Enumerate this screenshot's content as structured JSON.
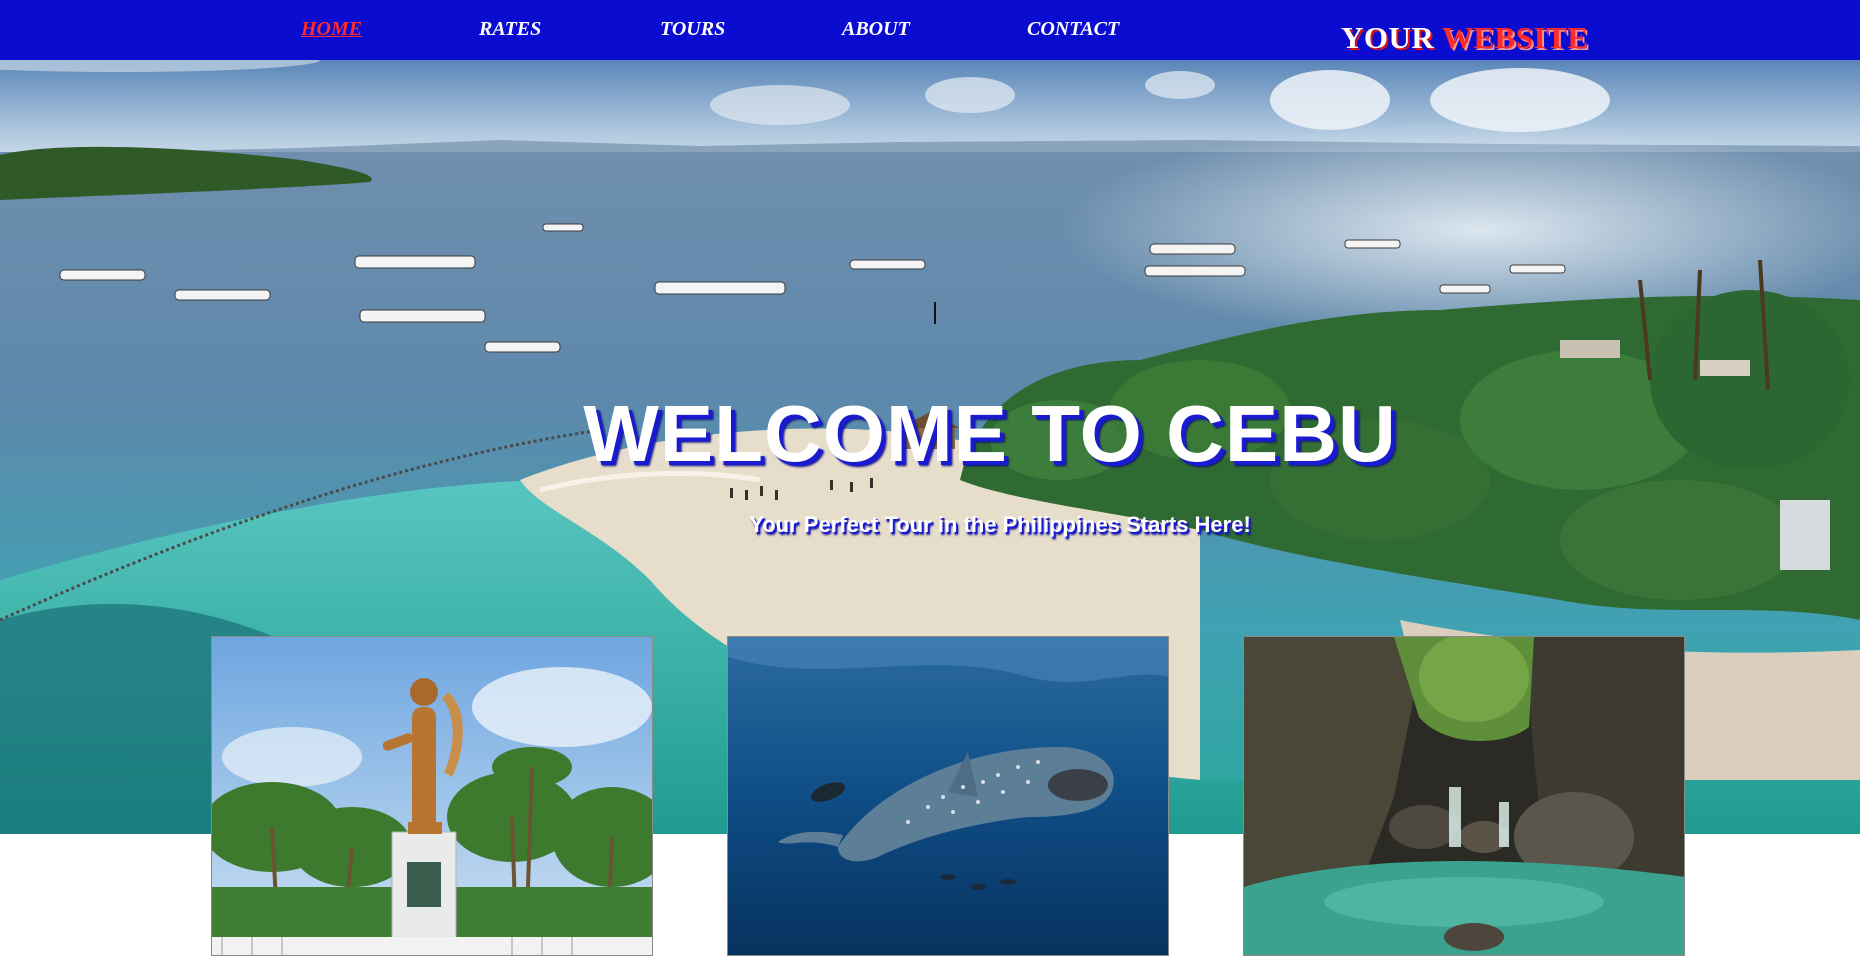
{
  "nav": {
    "items": [
      {
        "label": "HOME",
        "active": true
      },
      {
        "label": "RATES",
        "active": false
      },
      {
        "label": "TOURS",
        "active": false
      },
      {
        "label": "ABOUT",
        "active": false
      },
      {
        "label": "CONTACT",
        "active": false
      }
    ],
    "logo": {
      "part1": "YOUR",
      "part2": "WEBSITE"
    }
  },
  "hero": {
    "title": "WELCOME TO CEBU",
    "subtitle": "Your Perfect Tour in the Philippines Starts Here!",
    "image": "cebu-beach-aerial-photo"
  },
  "cards": [
    {
      "image": "lapu-lapu-statue-photo"
    },
    {
      "image": "whale-shark-photo"
    },
    {
      "image": "canyon-waterfall-photo"
    }
  ],
  "colors": {
    "nav_bg": "#0a0ccf",
    "nav_active": "#ff2a2a",
    "nav_text": "#ffffff",
    "title_shadow": "#1a1ad0"
  }
}
